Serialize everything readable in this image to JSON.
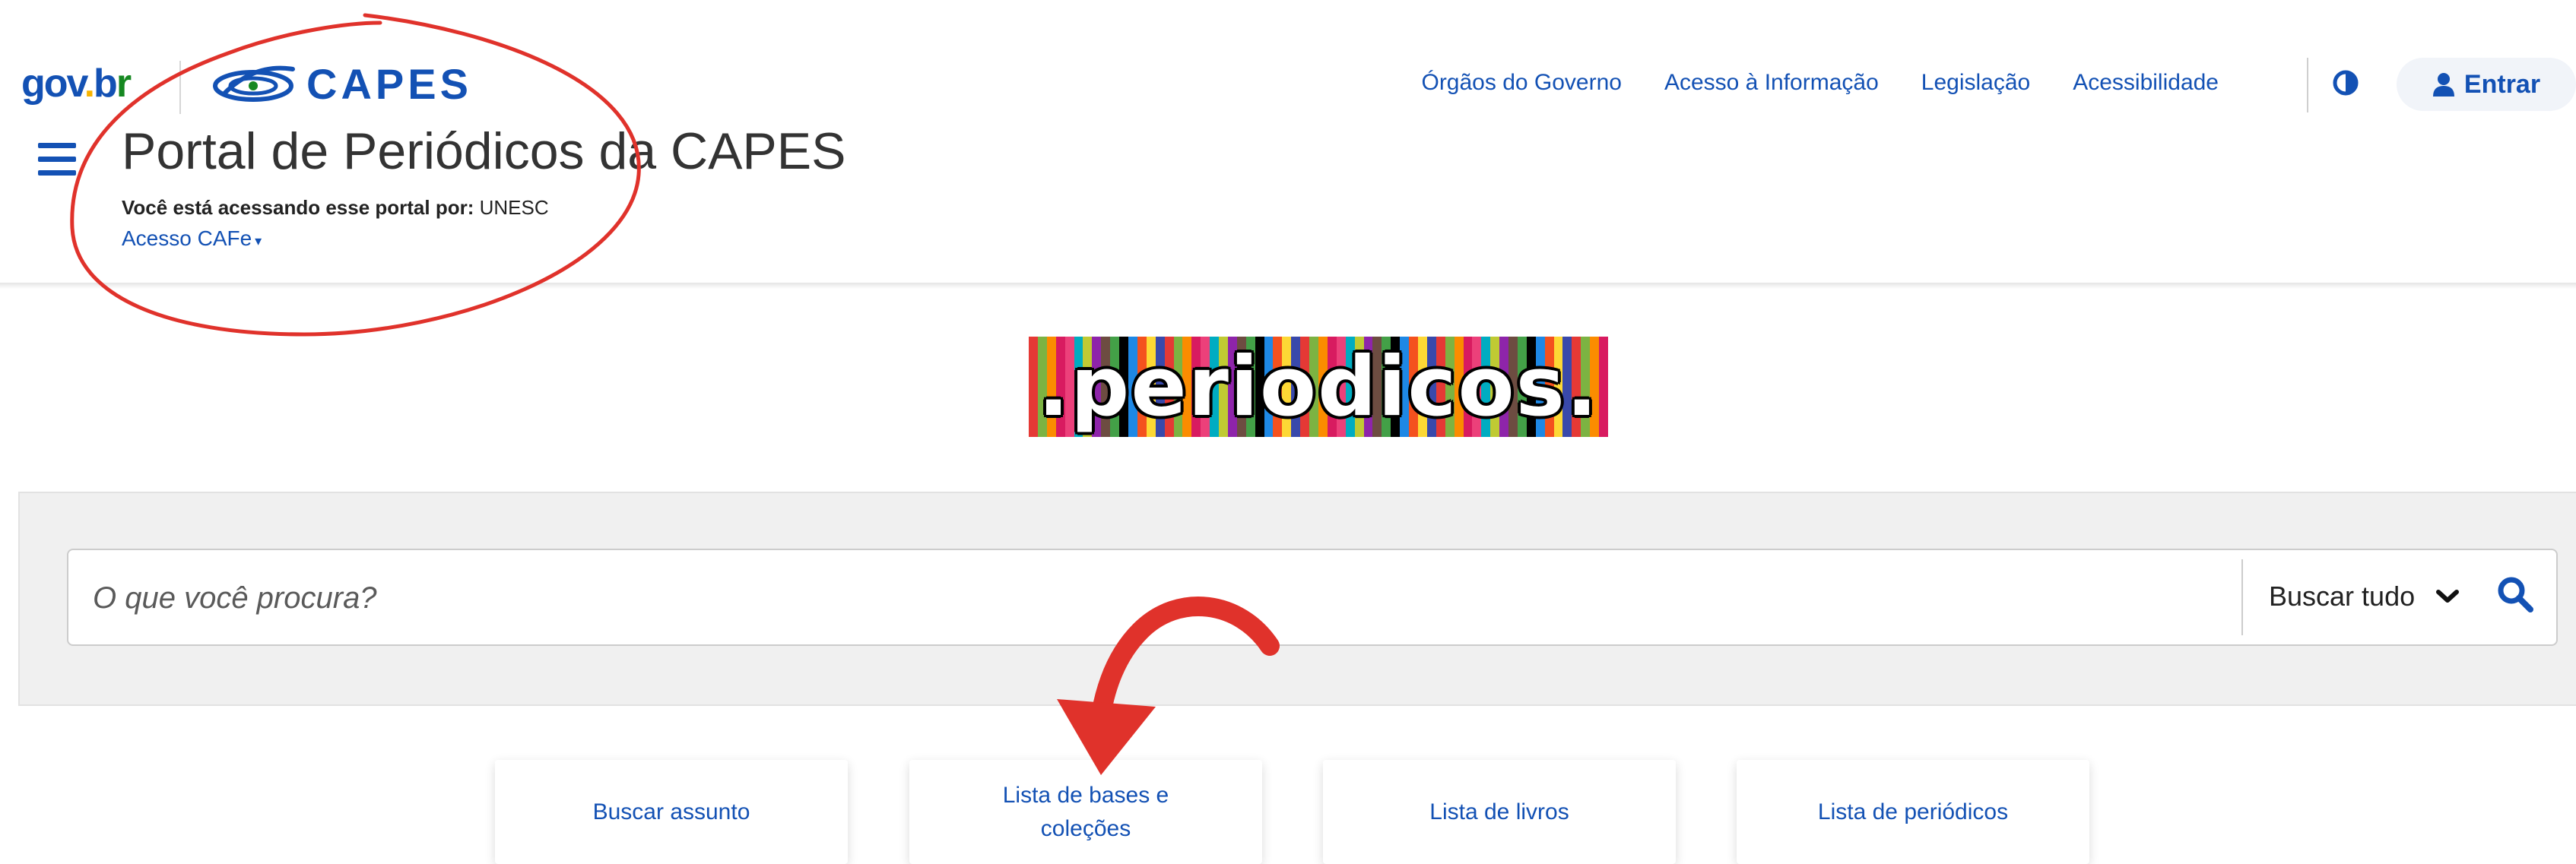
{
  "header": {
    "govbr_logo": {
      "part1": "gov",
      "part2": ".",
      "part3": "b",
      "part4": "r"
    },
    "capes_logo": "CAPES",
    "portal_title": "Portal de Periódicos da CAPES",
    "access_prefix": "Você está acessando esse portal por:",
    "access_institution": "UNESC",
    "cafe_link": "Acesso CAFe",
    "nav_links": [
      "Órgãos do Governo",
      "Acesso à Informação",
      "Legislação",
      "Acessibilidade"
    ],
    "login_label": "Entrar"
  },
  "icons": {
    "menu": "hamburger-menu-icon",
    "contrast": "contrast-icon",
    "user": "user-icon",
    "chevron": "chevron-down-icon",
    "search": "search-icon"
  },
  "banner": {
    "text": ".periodicos."
  },
  "search": {
    "placeholder": "O que você procura?",
    "scope": "Buscar tudo"
  },
  "cards": [
    {
      "label": "Buscar assunto"
    },
    {
      "label": "Lista de bases e coleções"
    },
    {
      "label": "Lista de livros"
    },
    {
      "label": "Lista de periódicos"
    }
  ],
  "colors": {
    "primary_blue": "#1351b4",
    "annotation_red": "#e0322b",
    "panel_gray": "#f0f0f0"
  }
}
